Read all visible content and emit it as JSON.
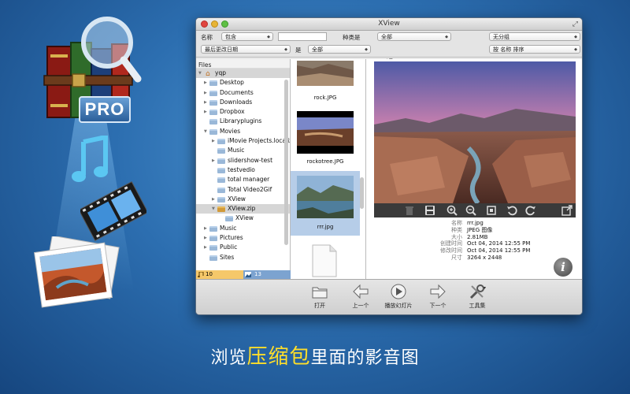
{
  "window": {
    "title": "XView"
  },
  "filters": {
    "name_label": "名称",
    "name_op": "包含",
    "name_value": "",
    "type_label": "种类是",
    "type_value": "全部",
    "group_value": "无分组",
    "date_field": "最后更改日期",
    "date_op_label": "是",
    "date_value": "全部",
    "sort_value": "按 名称 排序"
  },
  "files": {
    "header": "Files",
    "root": "yqp",
    "items": [
      "Desktop",
      "Documents",
      "Downloads",
      "Dropbox",
      "Libraryplugins",
      "Movies",
      "iMovie Projects.localized",
      "Music",
      "slidershow-test",
      "testvedio",
      "total manager",
      "Total Video2Gif",
      "XView",
      "XView.zip",
      "XView",
      "Music",
      "Pictures",
      "Public",
      "Sites"
    ],
    "count_audio": "10",
    "count_images": "13"
  },
  "thumbnails": [
    {
      "caption": "rock.JPG"
    },
    {
      "caption": "rockotree.JPG"
    },
    {
      "caption": "rrr.jpg"
    },
    {
      "caption": ""
    }
  ],
  "info": {
    "name_k": "名称",
    "name_v": "rrr.jpg",
    "kind_k": "种类",
    "kind_v": "JPEG 图像",
    "size_k": "大小",
    "size_v": "2.81MB",
    "created_k": "创建时间",
    "created_v": "Oct 04, 2014 12:55 PM",
    "modified_k": "修改时间",
    "modified_v": "Oct 04, 2014 12:55 PM",
    "dims_k": "尺寸",
    "dims_v": "3264 x 2448"
  },
  "toolbar": {
    "open": "打开",
    "prev": "上一个",
    "slideshow": "播放幻灯片",
    "next": "下一个",
    "tools": "工具集"
  },
  "caption": {
    "before": "浏览",
    "highlight": "压缩包",
    "after": "里面的影音图"
  },
  "promo": {
    "badge": "PRO"
  }
}
